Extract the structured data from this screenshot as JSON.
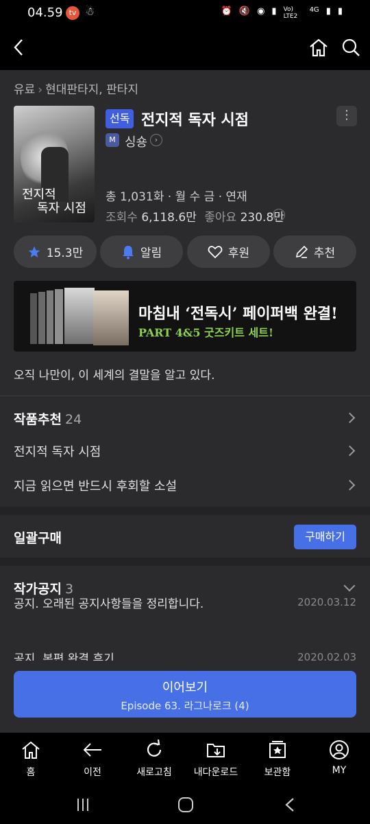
{
  "status_bar": {
    "time": "04.59",
    "badge": "tv",
    "icons": [
      "alarm-icon",
      "mute-icon",
      "wifi-icon",
      "hotspot-icon",
      "signal-icon",
      "volte-icon",
      "4g-icon",
      "signal-icon",
      "battery-icon"
    ],
    "volte": "Vo) LTE2",
    "net": "4G"
  },
  "header": {
    "back": "back-icon",
    "home": "home-icon",
    "search": "search-icon"
  },
  "breadcrumb": [
    "유료",
    "현대판타지, 판타지"
  ],
  "book": {
    "tag": "선독",
    "title": "전지적 독자 시점",
    "author": "싱숑",
    "info_line1": "총 1,031화 · 월 수 금 · 연재",
    "views_label": "조회수",
    "views": "6,118.6만",
    "likes_label": "좋아요",
    "likes": "230.8만",
    "cover_text_line1": "전지적",
    "cover_text_line2": "독자 시점"
  },
  "actions": [
    {
      "icon": "star-icon",
      "label": "15.3만"
    },
    {
      "icon": "bell-icon",
      "label": "알림"
    },
    {
      "icon": "heart-icon",
      "label": "후원"
    },
    {
      "icon": "pencil-icon",
      "label": "추천"
    }
  ],
  "banner": {
    "line1": "마침내 ‘전독시’ 페이퍼백 완결!",
    "line2": "PART 4&5 굿즈키트 세트!"
  },
  "description": "오직 나만이, 이 세계의 결말을 알고 있다.",
  "recommend": {
    "title": "작품추천",
    "count": "24",
    "items": [
      "전지적 독자 시점",
      "지금 읽으면 반드시 후회할 소설"
    ]
  },
  "bulk": {
    "title": "일괄구매",
    "button": "구매하기"
  },
  "notices": {
    "title": "작가공지",
    "count": "3",
    "items": [
      {
        "text": "공지. 오래된 공지사항들을 정리합니다.",
        "date": "2020.03.12"
      },
      {
        "text": "공지. 본편 완결 후기",
        "date": "2020.02.03"
      }
    ]
  },
  "continue": {
    "label": "이어보기",
    "episode": "Episode 63. 라그나로크 (4)"
  },
  "bottom_nav": [
    {
      "icon": "home-icon",
      "label": "홈"
    },
    {
      "icon": "back-arrow-icon",
      "label": "이전"
    },
    {
      "icon": "refresh-icon",
      "label": "새로고침"
    },
    {
      "icon": "download-folder-icon",
      "label": "내다운로드"
    },
    {
      "icon": "bookmark-star-icon",
      "label": "보관함"
    },
    {
      "icon": "user-icon",
      "label": "MY"
    }
  ],
  "colors": {
    "accent": "#4870e6",
    "bg": "#2b2b2d",
    "green": "#8fd14f"
  }
}
